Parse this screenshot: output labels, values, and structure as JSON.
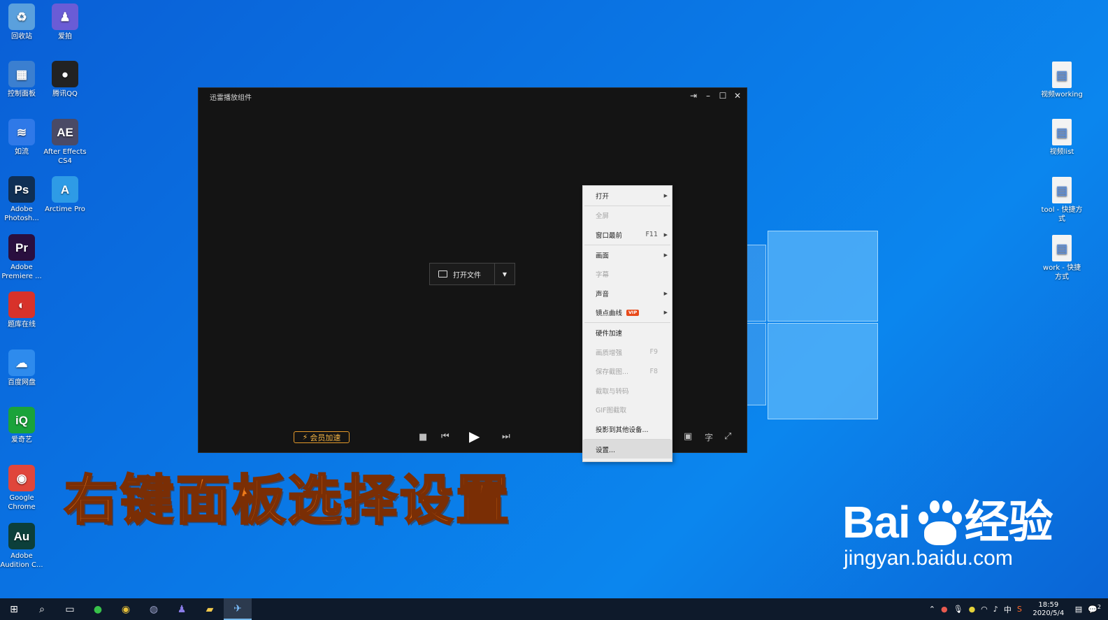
{
  "desktop": {
    "left_icons": [
      {
        "label": "回收站",
        "glyph": "♻",
        "color": "#5aa0dd",
        "icon": "recycle-bin-icon"
      },
      {
        "label": "爱拍",
        "glyph": "♟",
        "color": "#6a5cd6",
        "icon": "aipai-icon"
      },
      {
        "label": "控制面板",
        "glyph": "▦",
        "color": "#3b7fd0",
        "icon": "control-panel-icon"
      },
      {
        "label": "腾讯QQ",
        "glyph": "●",
        "color": "#222222",
        "icon": "qq-penguin-icon"
      },
      {
        "label": "如流",
        "glyph": "≋",
        "color": "#2f79e8",
        "icon": "ruliu-icon"
      },
      {
        "label": "After Effects CS4",
        "glyph": "AE",
        "color": "#4a4a66",
        "icon": "after-effects-icon"
      },
      {
        "label": "Adobe Photosh...",
        "glyph": "Ps",
        "color": "#0f2f55",
        "icon": "photoshop-icon"
      },
      {
        "label": "Arctime Pro",
        "glyph": "A",
        "color": "#2e9be6",
        "icon": "arctime-icon"
      },
      {
        "label": "Adobe Premiere ...",
        "glyph": "Pr",
        "color": "#2a0f3f",
        "icon": "premiere-icon"
      },
      {
        "label": "题库在线",
        "glyph": "◐",
        "color": "#d8322a",
        "icon": "tiku-icon"
      },
      {
        "label": "百度网盘",
        "glyph": "☁",
        "color": "#2e8bed",
        "icon": "baidu-netdisk-icon"
      },
      {
        "label": "爱奇艺",
        "glyph": "iQ",
        "color": "#1aa33a",
        "icon": "iqiyi-icon"
      },
      {
        "label": "Google Chrome",
        "glyph": "◉",
        "color": "#e0463b",
        "icon": "chrome-icon"
      },
      {
        "label": "Adobe Audition C...",
        "glyph": "Au",
        "color": "#0c3f3a",
        "icon": "audition-icon"
      }
    ],
    "right_icons": [
      {
        "label": "视频working",
        "icon": "file-shortcut-icon"
      },
      {
        "label": "视频list",
        "icon": "file-shortcut-icon"
      },
      {
        "label": "tool - 快捷方式",
        "icon": "file-shortcut-icon"
      },
      {
        "label": "work - 快捷方式",
        "icon": "folder-shortcut-icon"
      }
    ]
  },
  "player": {
    "title": "迅雷播放组件",
    "open_file": "打开文件",
    "vip_accel": "会员加速",
    "subtitle_btn": "字"
  },
  "context_menu": {
    "items": [
      {
        "label": "打开",
        "shortcut": "",
        "submenu": true,
        "disabled": false,
        "vip": false,
        "sep_after": true
      },
      {
        "label": "全屏",
        "shortcut": "",
        "submenu": false,
        "disabled": true,
        "vip": false,
        "sep_after": false
      },
      {
        "label": "窗口最前",
        "shortcut": "F11",
        "submenu": true,
        "disabled": false,
        "vip": false,
        "sep_after": true
      },
      {
        "label": "画面",
        "shortcut": "",
        "submenu": true,
        "disabled": false,
        "vip": false,
        "sep_after": false
      },
      {
        "label": "字幕",
        "shortcut": "",
        "submenu": false,
        "disabled": true,
        "vip": false,
        "sep_after": false
      },
      {
        "label": "声音",
        "shortcut": "",
        "submenu": true,
        "disabled": false,
        "vip": false,
        "sep_after": false
      },
      {
        "label": "镜点曲线",
        "shortcut": "",
        "submenu": true,
        "disabled": false,
        "vip": true,
        "sep_after": true
      },
      {
        "label": "硬件加速",
        "shortcut": "",
        "submenu": false,
        "disabled": false,
        "vip": false,
        "sep_after": false
      },
      {
        "label": "画质增强",
        "shortcut": "F9",
        "submenu": false,
        "disabled": true,
        "vip": false,
        "sep_after": false
      },
      {
        "label": "保存截图...",
        "shortcut": "F8",
        "submenu": false,
        "disabled": true,
        "vip": false,
        "sep_after": false
      },
      {
        "label": "截取与转码",
        "shortcut": "",
        "submenu": false,
        "disabled": true,
        "vip": false,
        "sep_after": false
      },
      {
        "label": "GIF图截取",
        "shortcut": "",
        "submenu": false,
        "disabled": true,
        "vip": false,
        "sep_after": false
      },
      {
        "label": "投影到其他设备...",
        "shortcut": "",
        "submenu": false,
        "disabled": false,
        "vip": false,
        "sep_after": true
      },
      {
        "label": "设置...",
        "shortcut": "",
        "submenu": false,
        "disabled": false,
        "vip": false,
        "sep_after": false,
        "hover": true
      }
    ],
    "vip_badge": "VIP"
  },
  "caption": "右键面板选择设置",
  "watermark": {
    "brand_left": "Bai",
    "brand_right": "经验",
    "url": "jingyan.baidu.com"
  },
  "taskbar": {
    "time": "18:59",
    "date": "2020/5/4",
    "ime": "中",
    "notification_count": "2"
  }
}
